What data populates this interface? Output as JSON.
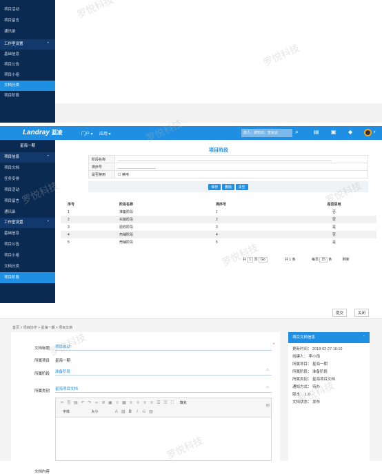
{
  "panel1": {
    "sidebar_items": [
      "项目活动",
      "项目留言",
      "通讯录"
    ],
    "section": "工作室设置",
    "sub_items": [
      "基础信息",
      "项目公告",
      "项目小组",
      "文档分类",
      "项目阶段"
    ],
    "active": "文档分类"
  },
  "panel2": {
    "brand": "Landray",
    "brand_cn": "蓝凌",
    "nav": [
      "门户 ▾",
      "应用 ▾"
    ],
    "search_placeholder": "找人、搜知识、查会议",
    "sidebar_title": "星海一期",
    "section1": "项目信息",
    "items1": [
      "项目文档",
      "任务安排",
      "项目活动",
      "项目留言",
      "通讯录"
    ],
    "section2": "工作室设置",
    "items2": [
      "基础信息",
      "项目公告",
      "项目小组",
      "文档分类",
      "项目阶段"
    ],
    "active": "项目阶段",
    "form_title": "项目阶段",
    "form": {
      "name_label": "阶段名称",
      "order_label": "排序号",
      "disabled_label": "是否禁用",
      "disabled_option": "禁用"
    },
    "buttons": [
      "保存",
      "删除",
      "清空"
    ],
    "columns": [
      "序号",
      "阶段名称",
      "排序号",
      "是否禁用"
    ],
    "rows": [
      [
        "1",
        "准备阶段",
        "1",
        "否"
      ],
      [
        "2",
        "实施阶段",
        "2",
        "否"
      ],
      [
        "3",
        "验收阶段",
        "3",
        "是"
      ],
      [
        "4",
        "売铺阶段",
        "4",
        "否"
      ],
      [
        "5",
        "売铺阶段",
        "5",
        "是"
      ]
    ],
    "pager": {
      "total_prefix": "共",
      "current": "1",
      "page_label": "页",
      "go": "Go",
      "count": "共 1 条",
      "per_page_prefix": "每页",
      "per_page": "15",
      "per_page_suffix": "条",
      "refresh": "刷新"
    }
  },
  "panel3": {
    "submit": "提交",
    "close": "关闭",
    "breadcrumb": [
      "首页",
      "项目协作",
      "星海一期",
      "项目文档"
    ],
    "fields": {
      "title_label": "文档标题",
      "title_value": "项目启动",
      "project_label": "所属项目",
      "project_value": "星海一期",
      "stage_label": "所属阶段",
      "stage_value": "准备阶段",
      "category_label": "所属类别",
      "category_value": "星海项目文档",
      "content_label": "文档内容"
    },
    "editor": {
      "font_label": "字体",
      "size_label": "大小",
      "style_label": "填充"
    },
    "info_title": "项目文档信息",
    "info": [
      "更新时间： 2018-02-27 16:10",
      "创建人： 李小雨",
      "所属项目： 星海一期",
      "所属阶段： 准备阶段",
      "所属类别： 星海项目文档",
      "通知方式： 待办",
      "版本： 1.0",
      "文档状态： 发布"
    ]
  },
  "watermark": "罗悦科技",
  "colors": {
    "sidebar": "#0a2a52",
    "accent": "#1e8fe3",
    "header": "#1e8fe3"
  }
}
